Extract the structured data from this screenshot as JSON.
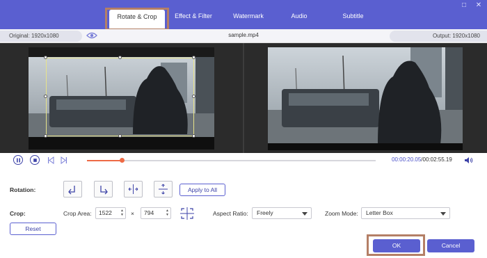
{
  "tabs": [
    {
      "label": "Rotate & Crop",
      "active": true
    },
    {
      "label": "Effect & Filter"
    },
    {
      "label": "Watermark"
    },
    {
      "label": "Audio"
    },
    {
      "label": "Subtitle"
    }
  ],
  "window": {
    "restore_glyph": "□",
    "close_glyph": "✕"
  },
  "info": {
    "original": "Original: 1920x1080",
    "filename": "sample.mp4",
    "output": "Output: 1920x1080"
  },
  "playback": {
    "current_time": "00:00:20.05",
    "separator": "/",
    "total_time": "00:02:55.19",
    "progress": 0.121
  },
  "rotation": {
    "label": "Rotation:",
    "buttons": [
      "rotate-left-icon",
      "rotate-right-icon",
      "flip-horizontal-icon",
      "flip-vertical-icon"
    ],
    "apply_all": "Apply to All"
  },
  "crop": {
    "label": "Crop:",
    "area_label": "Crop Area:",
    "width": "1522",
    "times": "×",
    "height": "794",
    "reset": "Reset",
    "aspect_label": "Aspect Ratio:",
    "aspect_value": "Freely",
    "zoom_label": "Zoom Mode:",
    "zoom_value": "Letter Box"
  },
  "actions": {
    "ok": "OK",
    "cancel": "Cancel"
  },
  "colors": {
    "accent": "#5a5fd0",
    "progress": "#ee6a45",
    "highlight": "#b47f66",
    "crop_border": "#e7e38a"
  }
}
